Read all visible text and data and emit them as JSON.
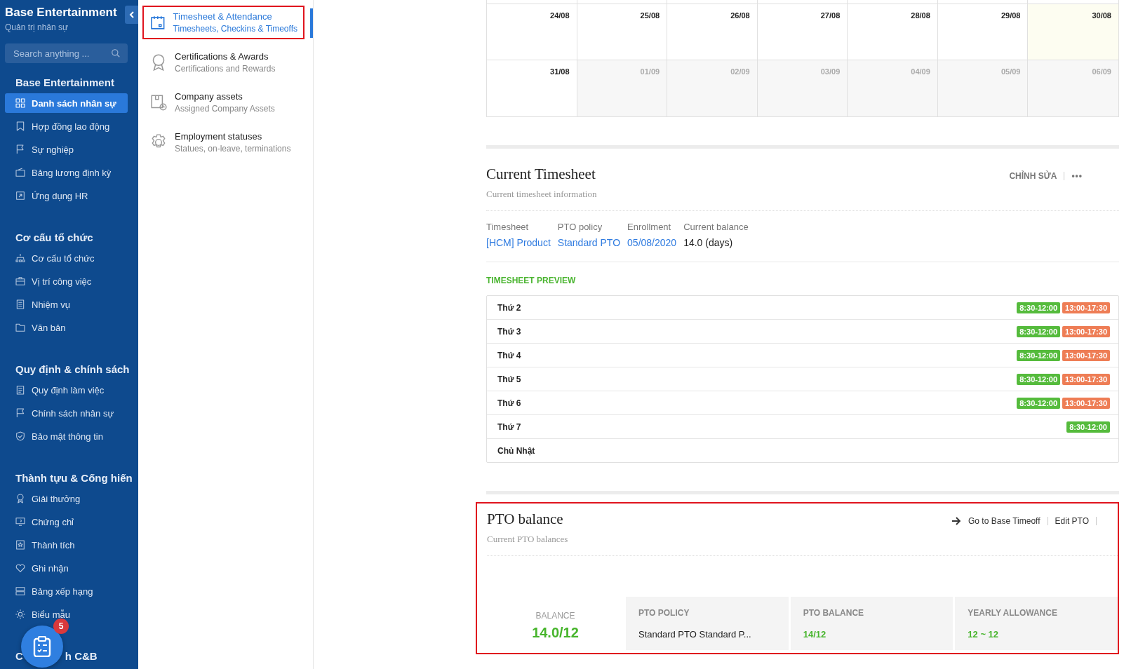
{
  "sidebar": {
    "title": "Base Entertainment",
    "subtitle": "Quản trị nhân sự",
    "search": {
      "placeholder": "Search anything ..."
    },
    "sections": [
      {
        "heading": "Base Entertainment",
        "items": [
          {
            "label": "Danh sách nhân sự",
            "selected": true
          },
          {
            "label": "Hợp đồng lao động",
            "selected": false
          },
          {
            "label": "Sự nghiệp",
            "selected": false
          },
          {
            "label": "Bảng lương định kỳ",
            "selected": false
          },
          {
            "label": "Ứng dụng HR",
            "selected": false
          }
        ]
      },
      {
        "heading": "Cơ cấu tổ chức",
        "items": [
          {
            "label": "Cơ cấu tổ chức",
            "selected": false
          },
          {
            "label": "Vị trí công việc",
            "selected": false
          },
          {
            "label": "Nhiệm vụ",
            "selected": false
          },
          {
            "label": "Văn bản",
            "selected": false
          }
        ]
      },
      {
        "heading": "Quy định & chính sách",
        "items": [
          {
            "label": "Quy định làm việc",
            "selected": false
          },
          {
            "label": "Chính sách nhân sự",
            "selected": false
          },
          {
            "label": "Bảo mật thông tin",
            "selected": false
          }
        ]
      },
      {
        "heading": "Thành tựu & Cống hiến",
        "items": [
          {
            "label": "Giải thưởng",
            "selected": false
          },
          {
            "label": "Chứng chỉ",
            "selected": false
          },
          {
            "label": "Thành tích",
            "selected": false
          },
          {
            "label": "Ghi nhận",
            "selected": false
          },
          {
            "label": "Bảng xếp hạng",
            "selected": false
          },
          {
            "label": "Biểu mẫu",
            "selected": false
          }
        ]
      },
      {
        "heading": "C",
        "heading_tail": "h C&B"
      }
    ],
    "float_button": {
      "badge": "5"
    }
  },
  "submenu": [
    {
      "title": "Timesheet & Attendance",
      "subtitle": "Timesheets, Checkins & Timeoffs",
      "selected": true,
      "highlighted": true
    },
    {
      "title": "Certifications & Awards",
      "subtitle": "Certifications and Rewards",
      "selected": false,
      "highlighted": false
    },
    {
      "title": "Company assets",
      "subtitle": "Assigned Company Assets",
      "selected": false,
      "highlighted": false
    },
    {
      "title": "Employment statuses",
      "subtitle": "Statues, on-leave, terminations",
      "selected": false,
      "highlighted": false
    }
  ],
  "calendar": {
    "weeks": [
      [
        {
          "date": "24/08",
          "other_month": false,
          "today": false
        },
        {
          "date": "25/08",
          "other_month": false,
          "today": false
        },
        {
          "date": "26/08",
          "other_month": false,
          "today": false
        },
        {
          "date": "27/08",
          "other_month": false,
          "today": false
        },
        {
          "date": "28/08",
          "other_month": false,
          "today": false
        },
        {
          "date": "29/08",
          "other_month": false,
          "today": false
        },
        {
          "date": "30/08",
          "other_month": false,
          "today": true
        }
      ],
      [
        {
          "date": "31/08",
          "other_month": false,
          "today": false
        },
        {
          "date": "01/09",
          "other_month": true,
          "today": false
        },
        {
          "date": "02/09",
          "other_month": true,
          "today": false
        },
        {
          "date": "03/09",
          "other_month": true,
          "today": false
        },
        {
          "date": "04/09",
          "other_month": true,
          "today": false
        },
        {
          "date": "05/09",
          "other_month": true,
          "today": false
        },
        {
          "date": "06/09",
          "other_month": true,
          "today": false
        }
      ]
    ]
  },
  "current_timesheet": {
    "title": "Current Timesheet",
    "subtitle": "Current timesheet information",
    "actions": {
      "edit": "CHỈNH SỬA",
      "more": "•••"
    },
    "fields": [
      {
        "label": "Timesheet",
        "value": "[HCM] Product",
        "kind": "link"
      },
      {
        "label": "PTO policy",
        "value": "Standard PTO",
        "kind": "link"
      },
      {
        "label": "Enrollment",
        "value": "05/08/2020",
        "kind": "link"
      },
      {
        "label": "Current balance",
        "value": "14.0 (days)",
        "kind": "plain"
      }
    ],
    "preview_heading": "TIMESHEET PREVIEW",
    "days": [
      {
        "day": "Thứ 2",
        "shifts": [
          {
            "label": "8:30-12:00",
            "kind": "morning"
          },
          {
            "label": "13:00-17:30",
            "kind": "afternoon"
          }
        ]
      },
      {
        "day": "Thứ 3",
        "shifts": [
          {
            "label": "8:30-12:00",
            "kind": "morning"
          },
          {
            "label": "13:00-17:30",
            "kind": "afternoon"
          }
        ]
      },
      {
        "day": "Thứ 4",
        "shifts": [
          {
            "label": "8:30-12:00",
            "kind": "morning"
          },
          {
            "label": "13:00-17:30",
            "kind": "afternoon"
          }
        ]
      },
      {
        "day": "Thứ 5",
        "shifts": [
          {
            "label": "8:30-12:00",
            "kind": "morning"
          },
          {
            "label": "13:00-17:30",
            "kind": "afternoon"
          }
        ]
      },
      {
        "day": "Thứ 6",
        "shifts": [
          {
            "label": "8:30-12:00",
            "kind": "morning"
          },
          {
            "label": "13:00-17:30",
            "kind": "afternoon"
          }
        ]
      },
      {
        "day": "Thứ 7",
        "shifts": [
          {
            "label": "8:30-12:00",
            "kind": "morning"
          }
        ]
      },
      {
        "day": "Chủ Nhật"
      }
    ]
  },
  "pto_balance": {
    "title": "PTO balance",
    "subtitle": "Current PTO balances",
    "highlighted": true,
    "actions": {
      "go": "Go to Base Timeoff",
      "edit": "Edit PTO"
    },
    "balance": {
      "label": "BALANCE",
      "value": "14.0/12"
    },
    "cards": [
      {
        "label": "PTO POLICY",
        "value": "Standard PTO Standard P...",
        "kind": "plain"
      },
      {
        "label": "PTO BALANCE",
        "value": "14/12",
        "kind": "accent"
      },
      {
        "label": "YEARLY ALLOWANCE",
        "value": "12 ~ 12",
        "kind": "accent"
      }
    ]
  }
}
